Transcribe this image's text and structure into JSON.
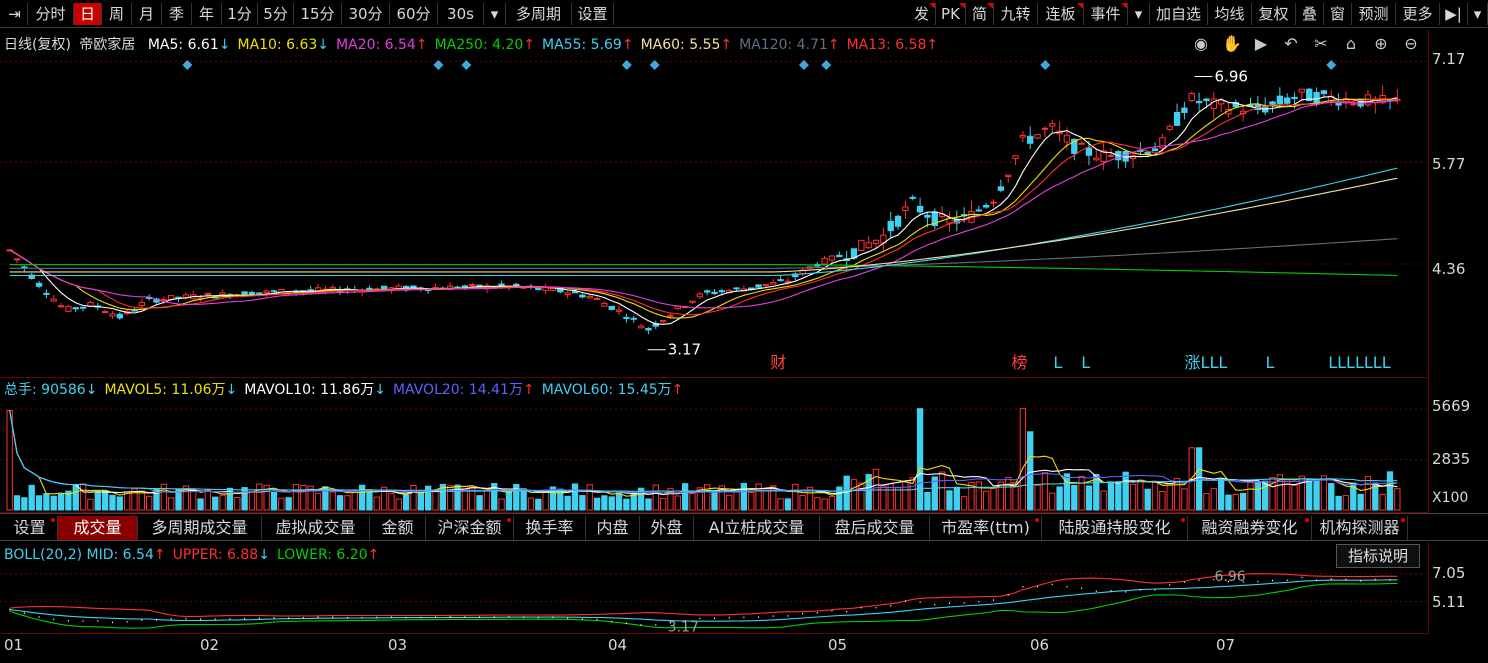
{
  "toolbar": {
    "left": [
      "⇥",
      "分时",
      "日",
      "周",
      "月",
      "季",
      "年",
      "1分",
      "5分",
      "15分",
      "30分",
      "60分",
      "30s",
      "▾",
      "多周期",
      "设置"
    ],
    "active_index": 2,
    "right": [
      "发",
      "PK",
      "简",
      "九转",
      "连板",
      "事件",
      "▾",
      "加自选",
      "均线",
      "复权",
      "叠",
      "窗",
      "预测",
      "更多",
      "▶|",
      "▾"
    ]
  },
  "main": {
    "title": "日线(复权)",
    "stock": "帝欧家居",
    "ma": [
      {
        "label": "MA5: 6.61",
        "arrow": "↓",
        "color": "#ffffff"
      },
      {
        "label": "MA10: 6.63",
        "arrow": "↓",
        "color": "#f0e000"
      },
      {
        "label": "MA20: 6.54",
        "arrow": "↑",
        "color": "#e040e0"
      },
      {
        "label": "MA250: 4.20",
        "arrow": "↑",
        "color": "#00d000"
      },
      {
        "label": "MA55: 5.69",
        "arrow": "↑",
        "color": "#40d0f0"
      },
      {
        "label": "MA60: 5.55",
        "arrow": "↑",
        "color": "#f0e0a0"
      },
      {
        "label": "MA120: 4.71",
        "arrow": "↑",
        "color": "#607080"
      },
      {
        "label": "MA13: 6.58",
        "arrow": "↑",
        "color": "#ff3030"
      }
    ],
    "icons": [
      "eye-icon",
      "hand-icon",
      "play-icon",
      "undo-icon",
      "scissors-icon",
      "lock-icon",
      "zoom-in-icon",
      "zoom-out-icon"
    ],
    "y_labels": [
      "7.17",
      "5.77",
      "4.36"
    ],
    "high_label": "6.96",
    "low_label": "3.17",
    "markers": [
      {
        "text": "财",
        "x": 0.555
      },
      {
        "text": "榜",
        "x": 0.728
      },
      {
        "text": "L",
        "x": 0.758
      },
      {
        "text": "L",
        "x": 0.778
      },
      {
        "text": "涨LLL",
        "x": 0.852
      },
      {
        "text": "L",
        "x": 0.91
      },
      {
        "text": "LLLLLLL",
        "x": 0.955
      }
    ]
  },
  "volume": {
    "legend": [
      {
        "label": "总手: 90586",
        "arrow": "↓",
        "color": "#40d0f0"
      },
      {
        "label": "MAVOL5: 11.06万",
        "arrow": "↓",
        "color": "#f0e000"
      },
      {
        "label": "MAVOL10: 11.86万",
        "arrow": "↓",
        "color": "#ffffff"
      },
      {
        "label": "MAVOL20: 14.41万",
        "arrow": "↑",
        "color": "#6060ff"
      },
      {
        "label": "MAVOL60: 15.45万",
        "arrow": "↑",
        "color": "#40d0f0"
      }
    ],
    "y_labels": [
      "5669",
      "2835"
    ],
    "unit": "X100"
  },
  "tabs": [
    {
      "label": "设置",
      "dot": true
    },
    {
      "label": "成交量",
      "dot": false
    },
    {
      "label": "多周期成交量",
      "dot": false
    },
    {
      "label": "虚拟成交量",
      "dot": false
    },
    {
      "label": "金额",
      "dot": false
    },
    {
      "label": "沪深金额",
      "dot": true
    },
    {
      "label": "换手率",
      "dot": false
    },
    {
      "label": "内盘",
      "dot": false
    },
    {
      "label": "外盘",
      "dot": false
    },
    {
      "label": "AI立桩成交量",
      "dot": false
    },
    {
      "label": "盘后成交量",
      "dot": false
    },
    {
      "label": "市盈率(ttm)",
      "dot": true
    },
    {
      "label": "陆股通持股变化",
      "dot": true
    },
    {
      "label": "融资融券变化",
      "dot": true
    },
    {
      "label": "机构探测器",
      "dot": true
    }
  ],
  "tab_active": 1,
  "boll": {
    "legend": [
      {
        "label": "BOLL(20,2) MID: 6.54",
        "arrow": "↑",
        "color": "#40d0f0"
      },
      {
        "label": "UPPER: 6.88",
        "arrow": "↓",
        "color": "#ff3030"
      },
      {
        "label": "LOWER: 6.20",
        "arrow": "↑",
        "color": "#00d000"
      }
    ],
    "desc_button": "指标说明",
    "y_labels": [
      "7.05",
      "5.11"
    ],
    "high_label": "6.96",
    "low_label": "3.17"
  },
  "x_labels": [
    "01",
    "02",
    "03",
    "04",
    "05",
    "06",
    "07"
  ],
  "chart_data": {
    "type": "candlestick",
    "y_range": [
      3.0,
      7.3
    ],
    "y_ticks": [
      7.17,
      5.77,
      4.36
    ],
    "x_month_labels": [
      "01",
      "02",
      "03",
      "04",
      "05",
      "06",
      "07"
    ],
    "price_anchors": [
      {
        "t": 0.0,
        "p": 4.55
      },
      {
        "t": 0.02,
        "p": 4.1
      },
      {
        "t": 0.04,
        "p": 3.72
      },
      {
        "t": 0.06,
        "p": 3.8
      },
      {
        "t": 0.08,
        "p": 3.62
      },
      {
        "t": 0.1,
        "p": 3.86
      },
      {
        "t": 0.14,
        "p": 3.92
      },
      {
        "t": 0.2,
        "p": 3.98
      },
      {
        "t": 0.28,
        "p": 4.02
      },
      {
        "t": 0.36,
        "p": 4.05
      },
      {
        "t": 0.4,
        "p": 3.98
      },
      {
        "t": 0.42,
        "p": 3.9
      },
      {
        "t": 0.44,
        "p": 3.7
      },
      {
        "t": 0.46,
        "p": 3.45
      },
      {
        "t": 0.48,
        "p": 3.72
      },
      {
        "t": 0.5,
        "p": 3.95
      },
      {
        "t": 0.53,
        "p": 4.02
      },
      {
        "t": 0.56,
        "p": 4.12
      },
      {
        "t": 0.58,
        "p": 4.35
      },
      {
        "t": 0.61,
        "p": 4.55
      },
      {
        "t": 0.63,
        "p": 4.75
      },
      {
        "t": 0.65,
        "p": 5.2
      },
      {
        "t": 0.67,
        "p": 4.95
      },
      {
        "t": 0.69,
        "p": 4.98
      },
      {
        "t": 0.71,
        "p": 5.3
      },
      {
        "t": 0.73,
        "p": 6.05
      },
      {
        "t": 0.75,
        "p": 6.25
      },
      {
        "t": 0.77,
        "p": 5.95
      },
      {
        "t": 0.79,
        "p": 5.85
      },
      {
        "t": 0.81,
        "p": 5.9
      },
      {
        "t": 0.83,
        "p": 6.0
      },
      {
        "t": 0.85,
        "p": 6.65
      },
      {
        "t": 0.87,
        "p": 6.55
      },
      {
        "t": 0.9,
        "p": 6.5
      },
      {
        "t": 0.93,
        "p": 6.7
      },
      {
        "t": 0.96,
        "p": 6.65
      },
      {
        "t": 0.985,
        "p": 6.6
      }
    ],
    "high": {
      "value": 6.96,
      "t": 0.852
    },
    "low": {
      "value": 3.17,
      "t": 0.46
    },
    "ma_lines": [
      {
        "name": "MA250",
        "start": 4.35,
        "end": 4.2
      },
      {
        "name": "MA120",
        "start": 4.3,
        "end": 4.71
      },
      {
        "name": "MA55",
        "start": 4.2,
        "end": 5.69
      },
      {
        "name": "MA60",
        "start": 4.25,
        "end": 5.55
      }
    ],
    "volume_range": [
      0,
      6300
    ],
    "volume_ticks": [
      5669,
      2835
    ],
    "volume_spikes": [
      {
        "t": 0.0,
        "v": 5600
      },
      {
        "t": 0.655,
        "v": 5700
      },
      {
        "t": 0.73,
        "v": 5700
      },
      {
        "t": 0.735,
        "v": 4400
      },
      {
        "t": 0.855,
        "v": 3500
      }
    ],
    "boll_range": [
      3.0,
      8.0
    ],
    "boll_ticks": [
      7.05,
      5.11
    ]
  }
}
